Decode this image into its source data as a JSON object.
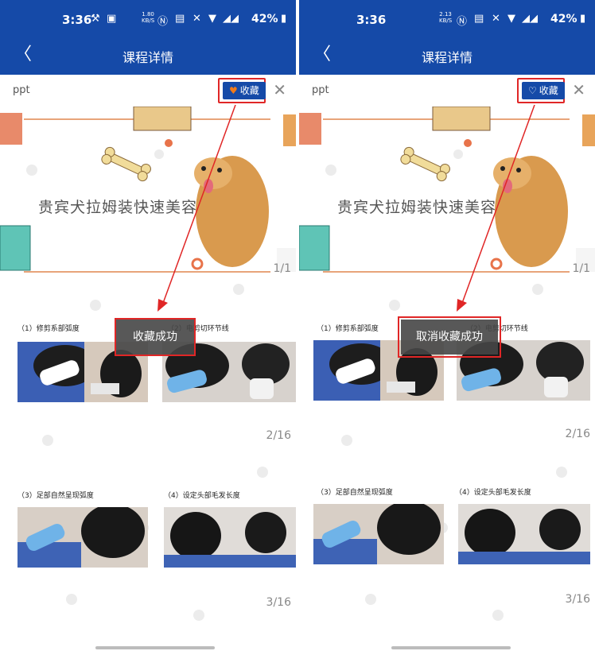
{
  "colors": {
    "brand_blue": "#154aa8",
    "highlight_red": "#e02626",
    "heart_orange": "#f07a1a"
  },
  "screens": [
    {
      "status": {
        "time": "3:36",
        "speed_top": "1.80",
        "speed_unit": "KB/S",
        "battery": "42%"
      },
      "nav": {
        "title": "课程详情",
        "back_icon": "chevron-left-icon"
      },
      "doc": {
        "name": "ppt",
        "favorite_label": "收藏",
        "favorite_icon": "heart-filled-icon",
        "close_icon": "close-icon"
      },
      "slide1": {
        "title": "贵宾犬拉姆装快速美容",
        "page": "1/1"
      },
      "slide2": {
        "captions": [
          "（1）修剪系部弧度",
          "（2）电剪切环节线"
        ],
        "page": "2/16"
      },
      "slide3": {
        "captions": [
          "（3）足部自然呈现弧度",
          "（4）设定头部毛发长度"
        ],
        "page": "3/16"
      },
      "toast": "收藏成功"
    },
    {
      "status": {
        "time": "3:36",
        "speed_top": "2.13",
        "speed_unit": "KB/S",
        "battery": "42%"
      },
      "nav": {
        "title": "课程详情",
        "back_icon": "chevron-left-icon"
      },
      "doc": {
        "name": "ppt",
        "favorite_label": "收藏",
        "favorite_icon": "heart-outline-icon",
        "close_icon": "close-icon"
      },
      "slide1": {
        "title": "贵宾犬拉姆装快速美容",
        "page": "1/1"
      },
      "slide2": {
        "captions": [
          "（1）修剪系部弧度",
          "（2）电剪切环节线"
        ],
        "page": "2/16"
      },
      "slide3": {
        "captions": [
          "（3）足部自然呈现弧度",
          "（4）设定头部毛发长度"
        ],
        "page": "3/16"
      },
      "toast": "取消收藏成功"
    }
  ]
}
